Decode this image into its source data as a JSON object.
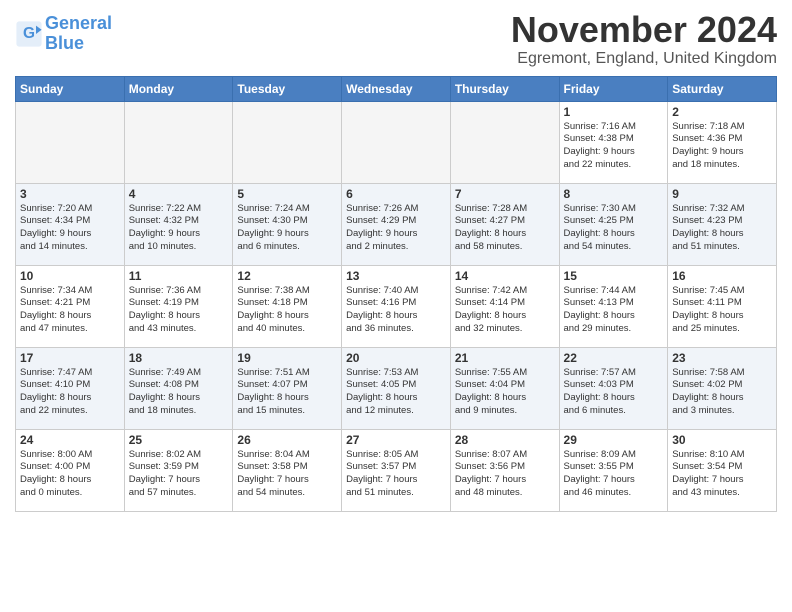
{
  "header": {
    "logo_line1": "General",
    "logo_line2": "Blue",
    "month_title": "November 2024",
    "location": "Egremont, England, United Kingdom"
  },
  "weekdays": [
    "Sunday",
    "Monday",
    "Tuesday",
    "Wednesday",
    "Thursday",
    "Friday",
    "Saturday"
  ],
  "weeks": [
    [
      {
        "day": "",
        "info": ""
      },
      {
        "day": "",
        "info": ""
      },
      {
        "day": "",
        "info": ""
      },
      {
        "day": "",
        "info": ""
      },
      {
        "day": "",
        "info": ""
      },
      {
        "day": "1",
        "info": "Sunrise: 7:16 AM\nSunset: 4:38 PM\nDaylight: 9 hours\nand 22 minutes."
      },
      {
        "day": "2",
        "info": "Sunrise: 7:18 AM\nSunset: 4:36 PM\nDaylight: 9 hours\nand 18 minutes."
      }
    ],
    [
      {
        "day": "3",
        "info": "Sunrise: 7:20 AM\nSunset: 4:34 PM\nDaylight: 9 hours\nand 14 minutes."
      },
      {
        "day": "4",
        "info": "Sunrise: 7:22 AM\nSunset: 4:32 PM\nDaylight: 9 hours\nand 10 minutes."
      },
      {
        "day": "5",
        "info": "Sunrise: 7:24 AM\nSunset: 4:30 PM\nDaylight: 9 hours\nand 6 minutes."
      },
      {
        "day": "6",
        "info": "Sunrise: 7:26 AM\nSunset: 4:29 PM\nDaylight: 9 hours\nand 2 minutes."
      },
      {
        "day": "7",
        "info": "Sunrise: 7:28 AM\nSunset: 4:27 PM\nDaylight: 8 hours\nand 58 minutes."
      },
      {
        "day": "8",
        "info": "Sunrise: 7:30 AM\nSunset: 4:25 PM\nDaylight: 8 hours\nand 54 minutes."
      },
      {
        "day": "9",
        "info": "Sunrise: 7:32 AM\nSunset: 4:23 PM\nDaylight: 8 hours\nand 51 minutes."
      }
    ],
    [
      {
        "day": "10",
        "info": "Sunrise: 7:34 AM\nSunset: 4:21 PM\nDaylight: 8 hours\nand 47 minutes."
      },
      {
        "day": "11",
        "info": "Sunrise: 7:36 AM\nSunset: 4:19 PM\nDaylight: 8 hours\nand 43 minutes."
      },
      {
        "day": "12",
        "info": "Sunrise: 7:38 AM\nSunset: 4:18 PM\nDaylight: 8 hours\nand 40 minutes."
      },
      {
        "day": "13",
        "info": "Sunrise: 7:40 AM\nSunset: 4:16 PM\nDaylight: 8 hours\nand 36 minutes."
      },
      {
        "day": "14",
        "info": "Sunrise: 7:42 AM\nSunset: 4:14 PM\nDaylight: 8 hours\nand 32 minutes."
      },
      {
        "day": "15",
        "info": "Sunrise: 7:44 AM\nSunset: 4:13 PM\nDaylight: 8 hours\nand 29 minutes."
      },
      {
        "day": "16",
        "info": "Sunrise: 7:45 AM\nSunset: 4:11 PM\nDaylight: 8 hours\nand 25 minutes."
      }
    ],
    [
      {
        "day": "17",
        "info": "Sunrise: 7:47 AM\nSunset: 4:10 PM\nDaylight: 8 hours\nand 22 minutes."
      },
      {
        "day": "18",
        "info": "Sunrise: 7:49 AM\nSunset: 4:08 PM\nDaylight: 8 hours\nand 18 minutes."
      },
      {
        "day": "19",
        "info": "Sunrise: 7:51 AM\nSunset: 4:07 PM\nDaylight: 8 hours\nand 15 minutes."
      },
      {
        "day": "20",
        "info": "Sunrise: 7:53 AM\nSunset: 4:05 PM\nDaylight: 8 hours\nand 12 minutes."
      },
      {
        "day": "21",
        "info": "Sunrise: 7:55 AM\nSunset: 4:04 PM\nDaylight: 8 hours\nand 9 minutes."
      },
      {
        "day": "22",
        "info": "Sunrise: 7:57 AM\nSunset: 4:03 PM\nDaylight: 8 hours\nand 6 minutes."
      },
      {
        "day": "23",
        "info": "Sunrise: 7:58 AM\nSunset: 4:02 PM\nDaylight: 8 hours\nand 3 minutes."
      }
    ],
    [
      {
        "day": "24",
        "info": "Sunrise: 8:00 AM\nSunset: 4:00 PM\nDaylight: 8 hours\nand 0 minutes."
      },
      {
        "day": "25",
        "info": "Sunrise: 8:02 AM\nSunset: 3:59 PM\nDaylight: 7 hours\nand 57 minutes."
      },
      {
        "day": "26",
        "info": "Sunrise: 8:04 AM\nSunset: 3:58 PM\nDaylight: 7 hours\nand 54 minutes."
      },
      {
        "day": "27",
        "info": "Sunrise: 8:05 AM\nSunset: 3:57 PM\nDaylight: 7 hours\nand 51 minutes."
      },
      {
        "day": "28",
        "info": "Sunrise: 8:07 AM\nSunset: 3:56 PM\nDaylight: 7 hours\nand 48 minutes."
      },
      {
        "day": "29",
        "info": "Sunrise: 8:09 AM\nSunset: 3:55 PM\nDaylight: 7 hours\nand 46 minutes."
      },
      {
        "day": "30",
        "info": "Sunrise: 8:10 AM\nSunset: 3:54 PM\nDaylight: 7 hours\nand 43 minutes."
      }
    ]
  ]
}
